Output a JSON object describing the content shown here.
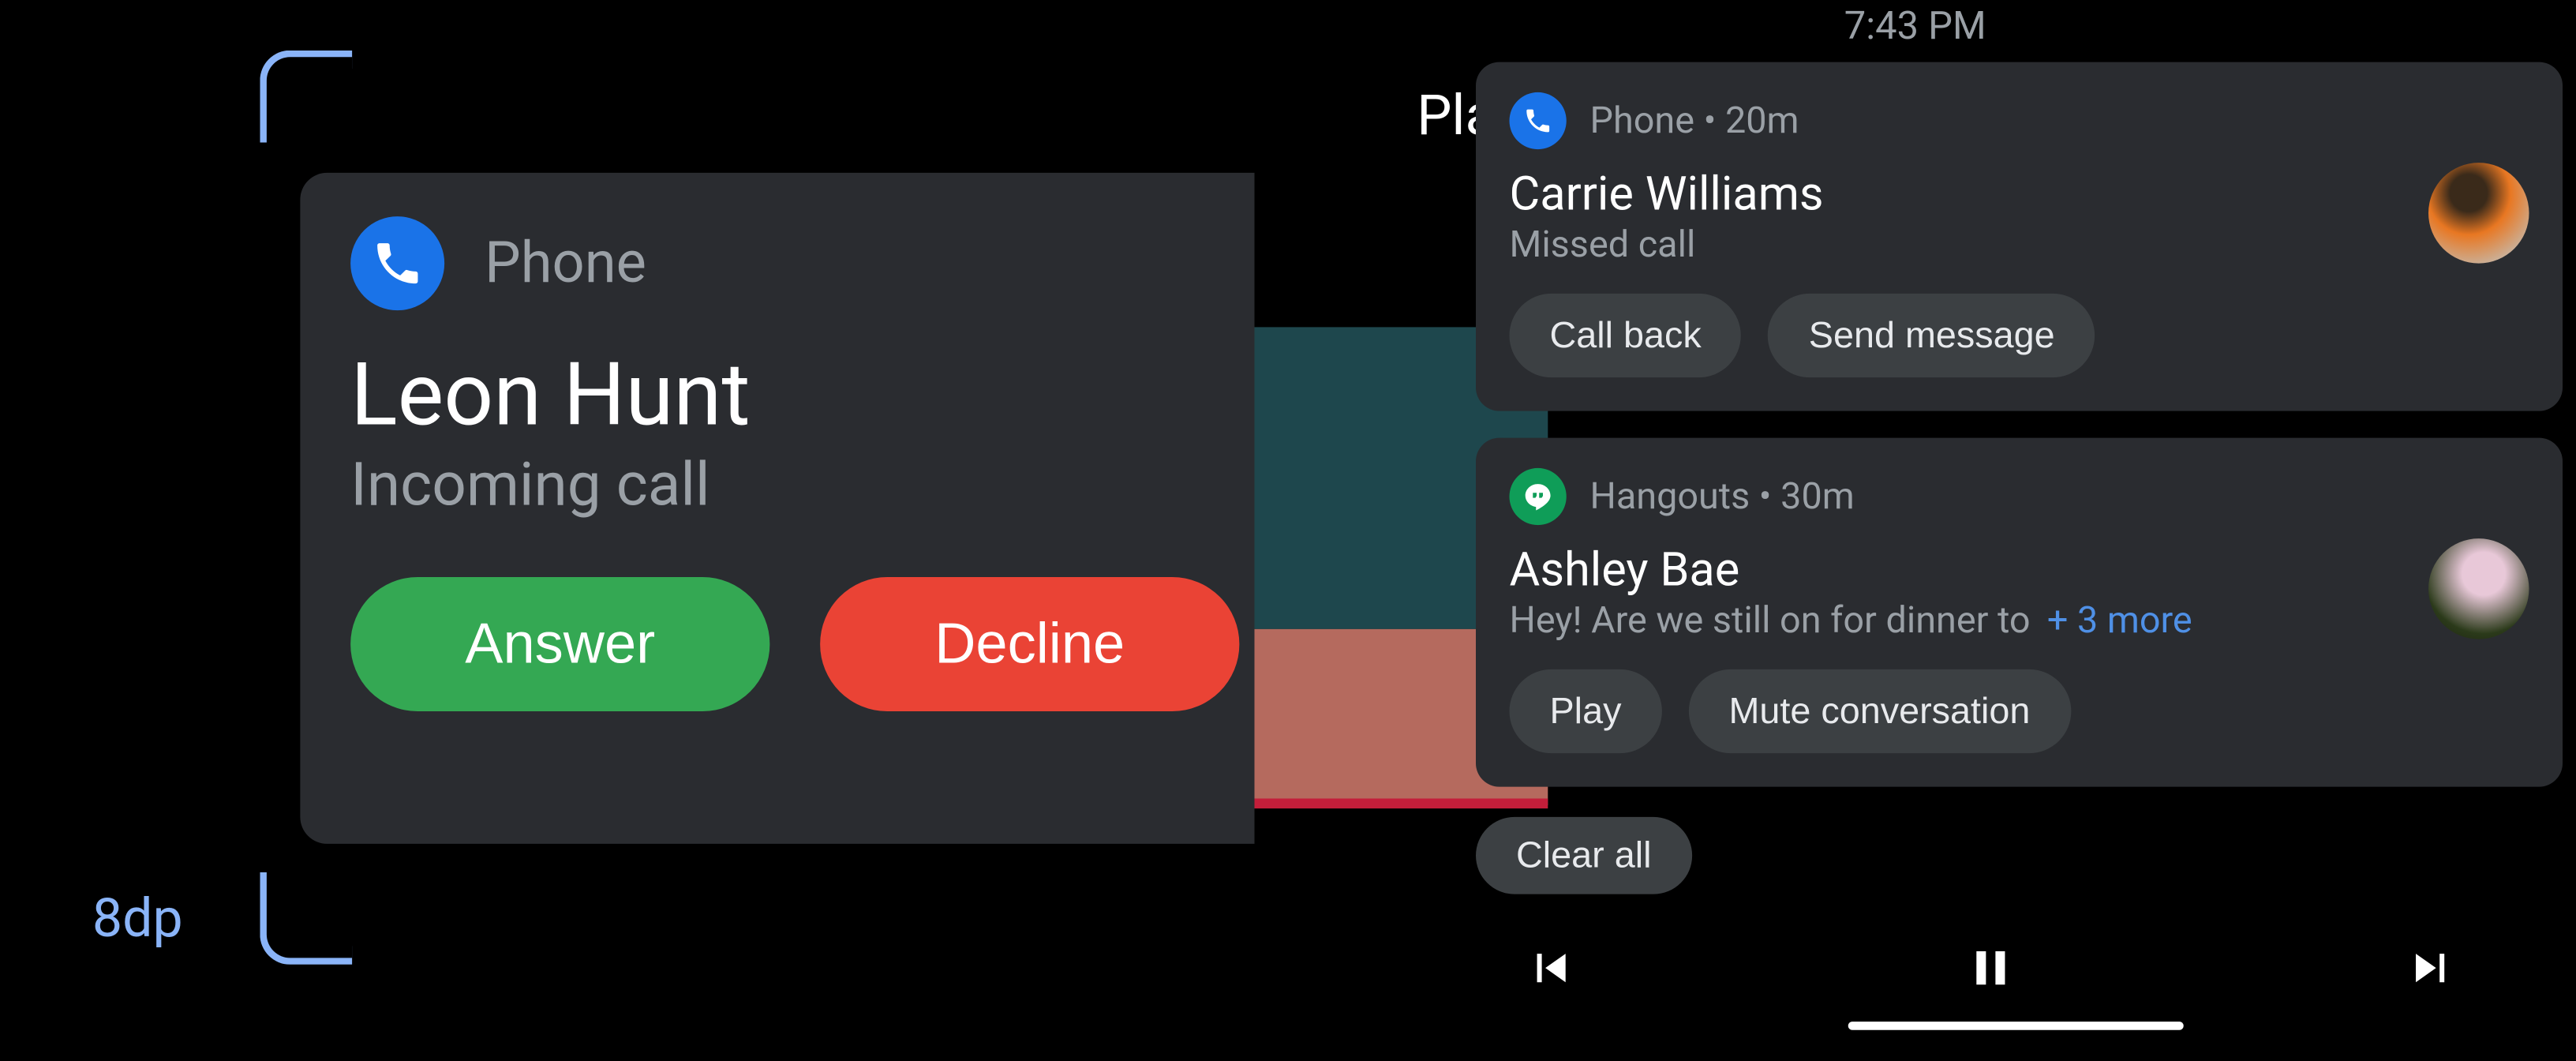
{
  "annotation": {
    "corner_label": "8dp"
  },
  "hud": {
    "app": "Phone",
    "name": "Leon Hunt",
    "status": "Incoming call",
    "answer_label": "Answer",
    "decline_label": "Decline"
  },
  "status_bar": {
    "time": "7:43 PM"
  },
  "now_playing_peek": "Playi",
  "notifications": [
    {
      "icon": "phone-icon",
      "app": "Phone",
      "sep": " • ",
      "time": "20m",
      "title": "Carrie Williams",
      "body": "Missed call",
      "more": "",
      "actions": [
        "Call back",
        "Send message"
      ],
      "avatar": "avatar-a"
    },
    {
      "icon": "hangouts-icon",
      "app": "Hangouts",
      "sep": " • ",
      "time": "30m",
      "title": "Ashley Bae",
      "body": "Hey! Are we still on for dinner to",
      "more": "+ 3 more",
      "actions": [
        "Play",
        "Mute conversation"
      ],
      "avatar": "avatar-b"
    }
  ],
  "clear_all_label": "Clear all"
}
